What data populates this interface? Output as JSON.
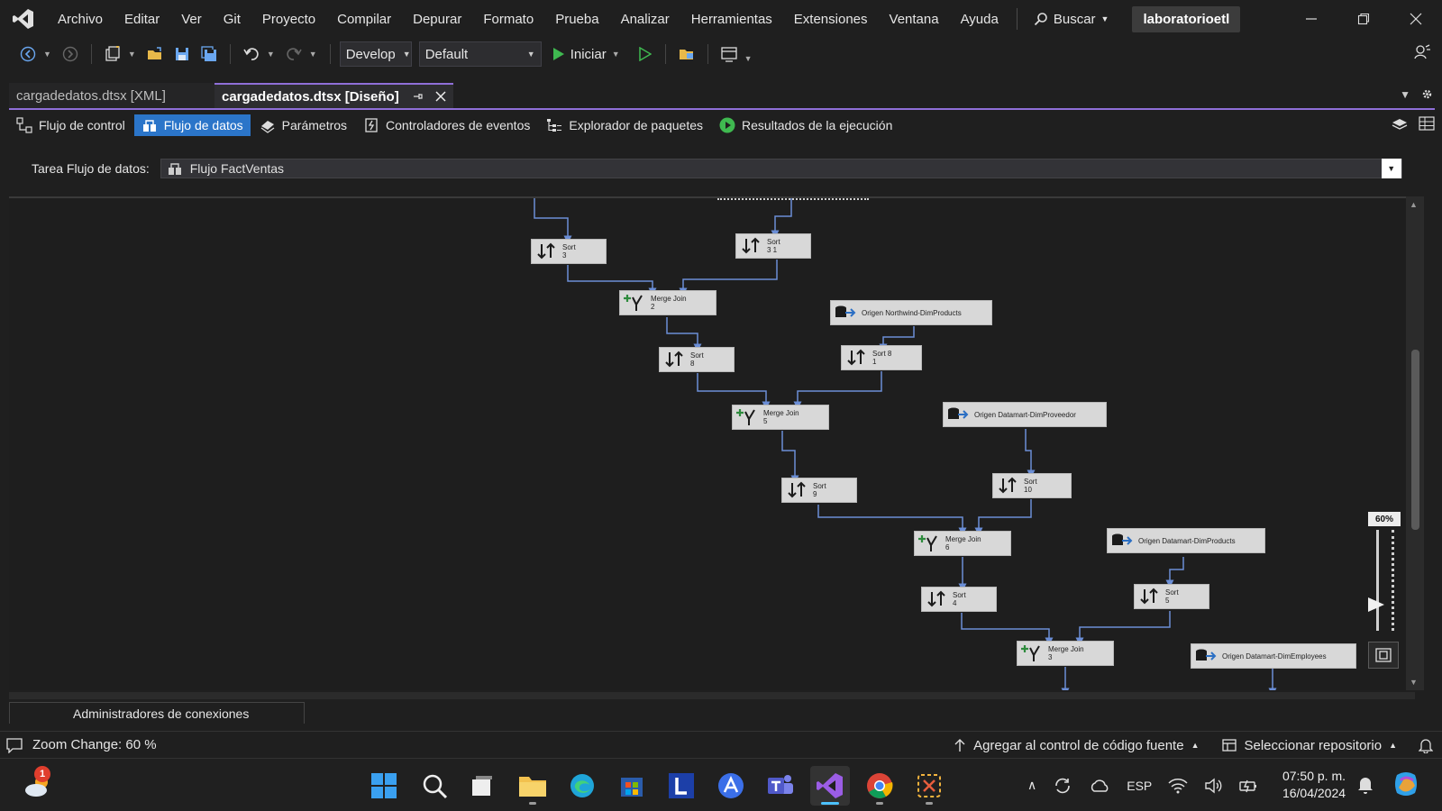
{
  "menubar": {
    "items": [
      "Archivo",
      "Editar",
      "Ver",
      "Git",
      "Proyecto",
      "Compilar",
      "Depurar",
      "Formato",
      "Prueba",
      "Analizar",
      "Herramientas",
      "Extensiones",
      "Ventana",
      "Ayuda"
    ],
    "search_label": "Buscar",
    "profile_label": "laboratorioetl"
  },
  "toolbar": {
    "config_dropdown": "Develop",
    "platform_dropdown": "Default",
    "start_label": "Iniciar"
  },
  "doc_tabs": {
    "inactive": "cargadedatos.dtsx [XML]",
    "active": "cargadedatos.dtsx [Diseño]"
  },
  "designer_tabs": {
    "control_flow": "Flujo de control",
    "data_flow": "Flujo de datos",
    "parameters": "Parámetros",
    "event_handlers": "Controladores de eventos",
    "package_explorer": "Explorador de paquetes",
    "results": "Resultados de la ejecución"
  },
  "task_row": {
    "label": "Tarea Flujo de datos:",
    "value": "Flujo FactVentas"
  },
  "nodes": {
    "sort3": {
      "name": "Sort",
      "sub": "3"
    },
    "sort31": {
      "name": "Sort",
      "sub": "3 1"
    },
    "mj2": {
      "name": "Merge Join",
      "sub": "2"
    },
    "src_nw_prod": {
      "name": "Origen Northwind-DimProducts"
    },
    "sort8": {
      "name": "Sort",
      "sub": "8"
    },
    "sort81": {
      "name": "Sort 8",
      "sub": "1"
    },
    "mj5": {
      "name": "Merge Join",
      "sub": "5"
    },
    "src_dm_prov": {
      "name": "Origen Datamart-DimProveedor"
    },
    "sort9": {
      "name": "Sort",
      "sub": "9"
    },
    "sort10": {
      "name": "Sort",
      "sub": "10"
    },
    "mj6": {
      "name": "Merge Join",
      "sub": "6"
    },
    "src_dm_prod": {
      "name": "Origen Datamart-DimProducts"
    },
    "sort4": {
      "name": "Sort",
      "sub": "4"
    },
    "sort5": {
      "name": "Sort",
      "sub": "5"
    },
    "mj3": {
      "name": "Merge Join",
      "sub": "3"
    },
    "src_dm_emp": {
      "name": "Origen Datamart-DimEmployees"
    }
  },
  "zoom": {
    "label": "60%",
    "level_percent": 60
  },
  "connection_managers_tab": "Administradores de conexiones",
  "statusbar": {
    "message": "Zoom Change: 60 %",
    "source_control": "Agregar al control de código fuente",
    "repository": "Seleccionar repositorio"
  },
  "taskbar": {
    "notification_count": "1",
    "language": "ESP",
    "time": "07:50 p. m.",
    "date": "16/04/2024"
  }
}
